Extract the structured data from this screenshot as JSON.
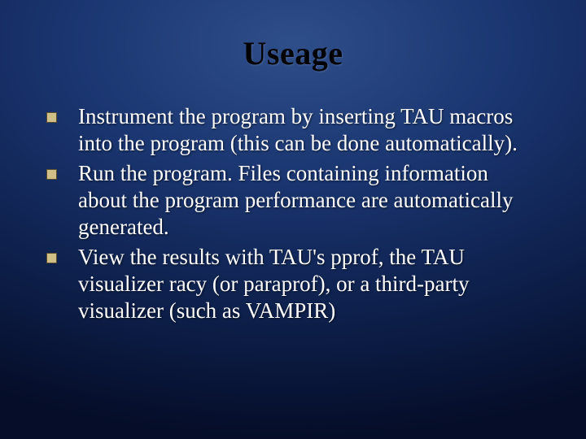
{
  "slide": {
    "title": "Useage",
    "bullets": [
      "Instrument the program by inserting TAU macros into the program (this can be done automatically).",
      "Run the program. Files containing information about the program performance are automatically generated.",
      "View the results with TAU's pprof, the TAU visualizer racy (or paraprof), or a third-party visualizer (such as VAMPIR)"
    ]
  }
}
